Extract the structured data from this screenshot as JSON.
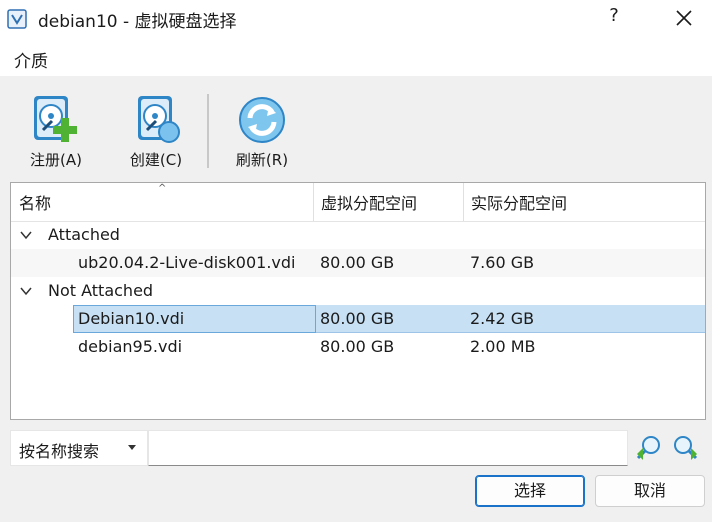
{
  "window": {
    "title": "debian10 - 虚拟硬盘选择",
    "help": "?",
    "close_icon": "close-icon"
  },
  "menu": {
    "items": [
      "介质"
    ]
  },
  "toolbar": {
    "register": {
      "label": "注册(A)",
      "icon": "disk-add-icon"
    },
    "create": {
      "label": "创建(C)",
      "icon": "disk-create-icon"
    },
    "refresh": {
      "label": "刷新(R)",
      "icon": "refresh-icon"
    }
  },
  "table": {
    "columns": [
      "名称",
      "虚拟分配空间",
      "实际分配空间"
    ],
    "groups": [
      {
        "label": "Attached",
        "rows": [
          {
            "name": "ub20.04.2-Live-disk001.vdi",
            "virtual": "80.00 GB",
            "actual": "7.60 GB",
            "selected": false
          }
        ]
      },
      {
        "label": "Not Attached",
        "rows": [
          {
            "name": "Debian10.vdi",
            "virtual": "80.00 GB",
            "actual": "2.42 GB",
            "selected": true
          },
          {
            "name": "debian95.vdi",
            "virtual": "80.00 GB",
            "actual": "2.00 MB",
            "selected": false
          }
        ]
      }
    ]
  },
  "search": {
    "mode": "按名称搜索",
    "value": "",
    "prev_icon": "search-previous-icon",
    "next_icon": "search-next-icon"
  },
  "buttons": {
    "choose": "选择",
    "cancel": "取消"
  },
  "colors": {
    "selection": "#c7e0f4",
    "accent": "#1a73c8",
    "icon_blue": "#2f86c7",
    "icon_green": "#4fb233"
  }
}
